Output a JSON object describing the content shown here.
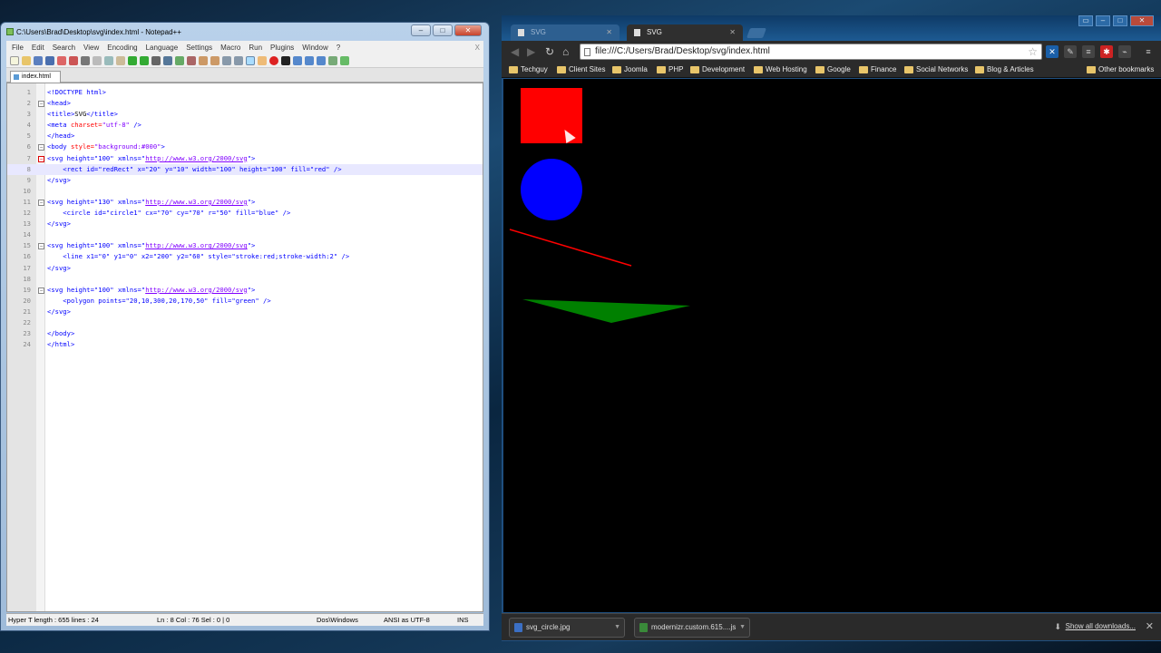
{
  "notepad": {
    "title": "C:\\Users\\Brad\\Desktop\\svg\\index.html - Notepad++",
    "menu": [
      "File",
      "Edit",
      "Search",
      "View",
      "Encoding",
      "Language",
      "Settings",
      "Macro",
      "Run",
      "Plugins",
      "Window",
      "?"
    ],
    "menu_close": "X",
    "tab_label": "index.html",
    "code_lines": [
      {
        "n": "1"
      },
      {
        "n": "2"
      },
      {
        "n": "3"
      },
      {
        "n": "4"
      },
      {
        "n": "5"
      },
      {
        "n": "6"
      },
      {
        "n": "7"
      },
      {
        "n": "8"
      },
      {
        "n": "9"
      },
      {
        "n": "10"
      },
      {
        "n": "11"
      },
      {
        "n": "12"
      },
      {
        "n": "13"
      },
      {
        "n": "14"
      },
      {
        "n": "15"
      },
      {
        "n": "16"
      },
      {
        "n": "17"
      },
      {
        "n": "18"
      },
      {
        "n": "19"
      },
      {
        "n": "20"
      },
      {
        "n": "21"
      },
      {
        "n": "22"
      },
      {
        "n": "23"
      },
      {
        "n": "24"
      }
    ],
    "code": {
      "l1": "<!DOCTYPE html>",
      "l2": "<head>",
      "l3_open": "<title>",
      "l3_text": "SVG",
      "l3_close": "</title>",
      "l4_tag": "<meta",
      "l4_attr": " charset=",
      "l4_val": "\"utf-8\"",
      "l4_end": " />",
      "l5": "</head>",
      "l6_tag": "<body",
      "l6_attr": " style=",
      "l6_val": "\"background:#000\"",
      "l6_end": ">",
      "svg_open_a": "<svg height=\"100\" xmlns=\"",
      "svg_url": "http://www.w3.org/2000/svg",
      "svg_open_b": "\">",
      "svg130_a": "<svg height=\"130\" xmlns=\"",
      "l8": "    <rect id=\"redRect\" x=\"20\" y=\"10\" width=\"100\" height=\"100\" fill=\"red\" />",
      "l12": "    <circle id=\"circle1\" cx=\"70\" cy=\"70\" r=\"50\" fill=\"blue\" />",
      "l16": "    <line x1=\"0\" y1=\"0\" x2=\"200\" y2=\"60\" style=\"stroke:red;stroke-width:2\" />",
      "l20": "    <polygon points=\"20,10,300,20,170,50\" fill=\"green\" />",
      "svg_close": "</svg>",
      "l23": "</body>",
      "l24": "</html>"
    },
    "status": {
      "left": "Hyper T length : 655    lines : 24",
      "pos": "Ln : 8    Col : 76    Sel : 0 | 0",
      "eol": "Dos\\Windows",
      "enc": "ANSI as UTF-8",
      "mode": "INS"
    }
  },
  "chrome": {
    "tabs": [
      {
        "label": "SVG"
      },
      {
        "label": "SVG"
      }
    ],
    "url": "file:///C:/Users/Brad/Desktop/svg/index.html",
    "bookmarks": [
      "Techguy",
      "Client Sites",
      "Joomla",
      "PHP",
      "Development",
      "Web Hosting",
      "Google",
      "Finance",
      "Social Networks",
      "Blog & Articles"
    ],
    "other_bookmarks": "Other bookmarks",
    "downloads": [
      "svg_circle.jpg",
      "modernizr.custom.615....js"
    ],
    "show_all": "Show all downloads..."
  },
  "svg_render": {
    "rect": {
      "fill": "red"
    },
    "circle": {
      "fill": "blue"
    },
    "line": {
      "stroke": "red"
    },
    "polygon": {
      "fill": "green"
    }
  },
  "colors": {
    "accent_tag": "#0000ff",
    "accent_attr": "#ff0000",
    "accent_value": "#8000ff"
  }
}
